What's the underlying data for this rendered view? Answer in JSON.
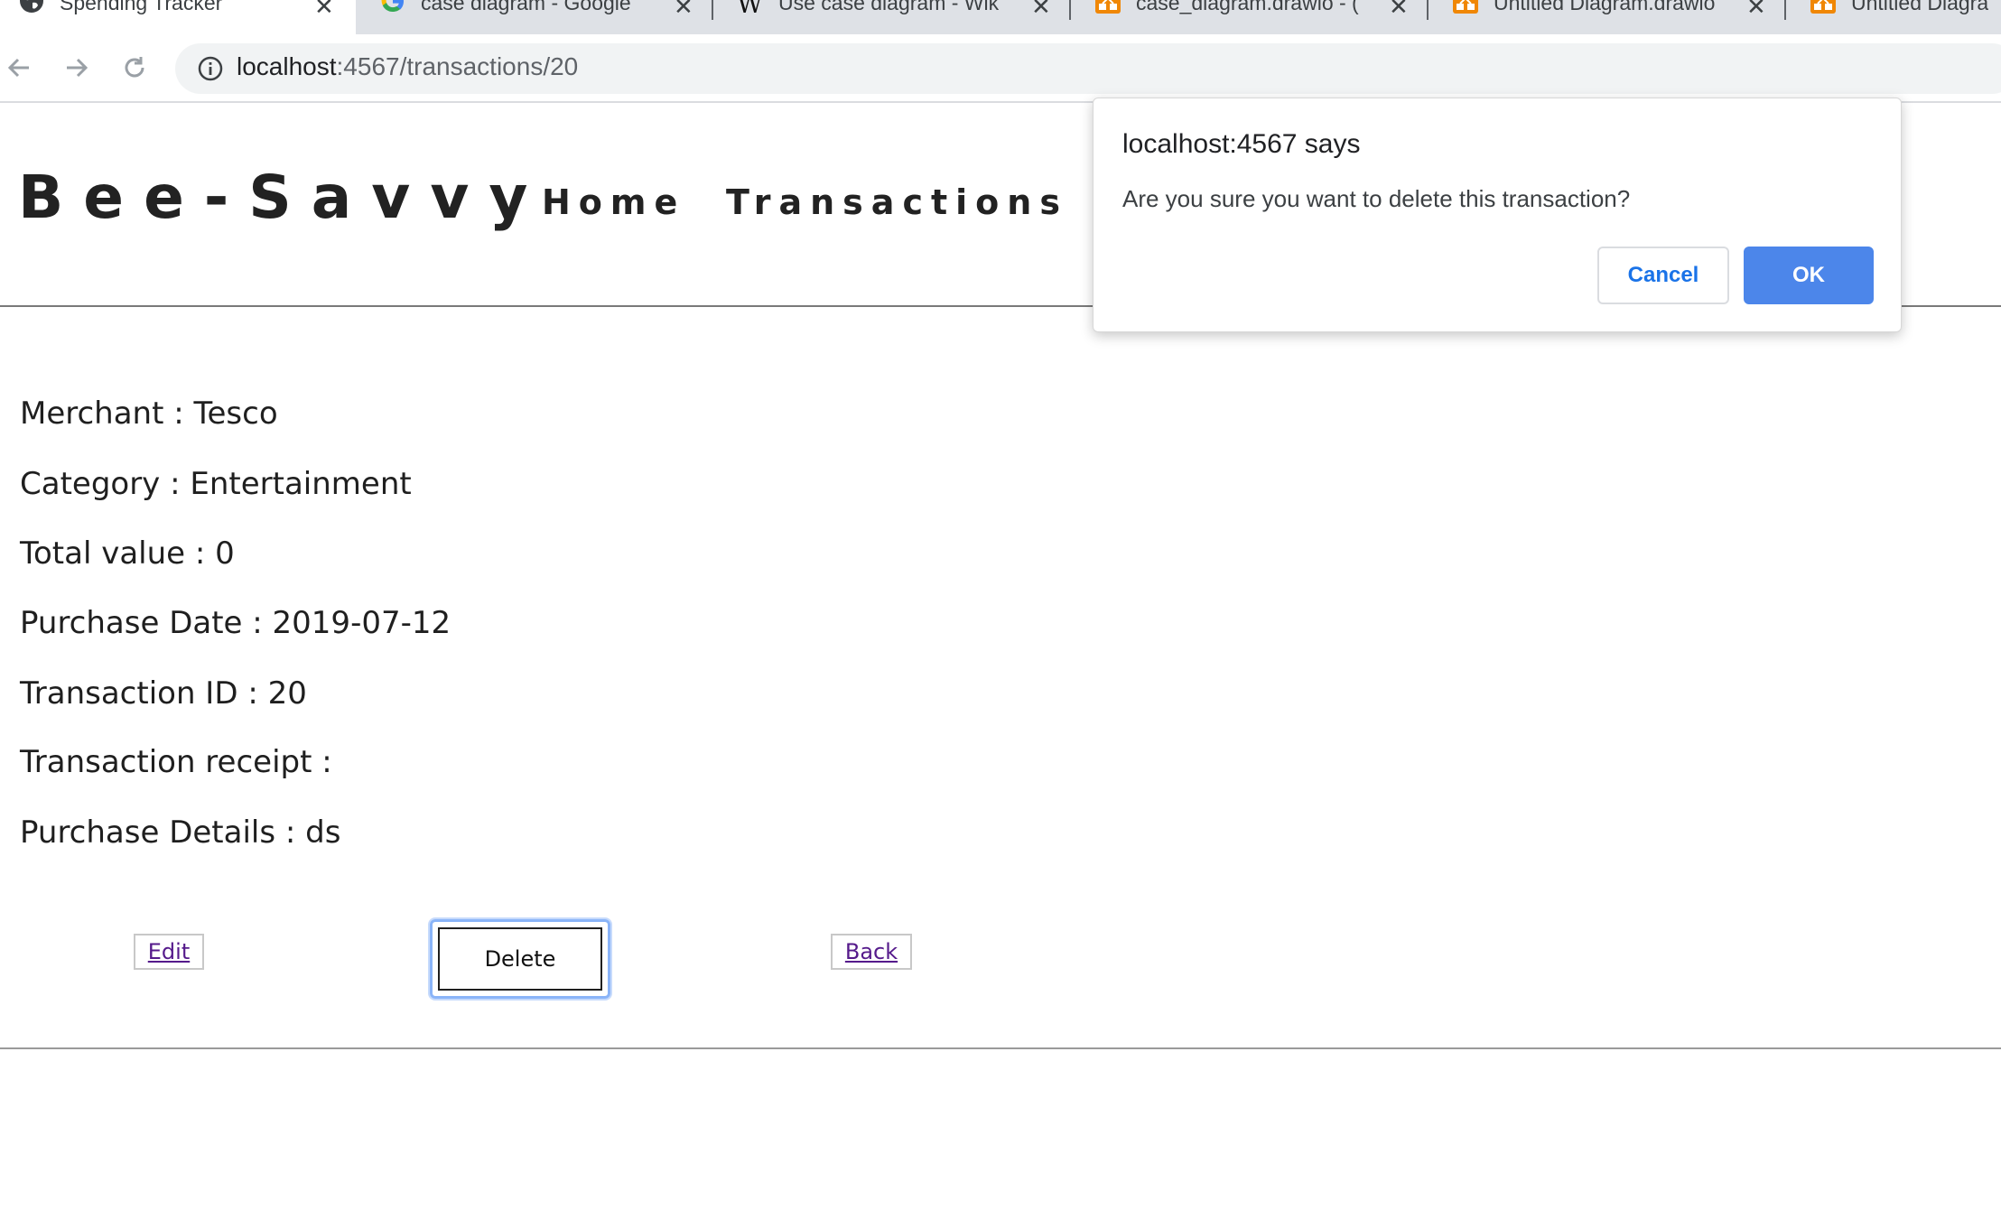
{
  "browser": {
    "tabs": [
      {
        "title": "Spending Tracker",
        "icon": "globe-icon",
        "active": true
      },
      {
        "title": "case diagram - Google",
        "icon": "google-icon",
        "active": false
      },
      {
        "title": "Use case diagram - Wik",
        "icon": "wikipedia-icon",
        "active": false
      },
      {
        "title": "case_diagram.drawio - (",
        "icon": "drawio-icon",
        "active": false
      },
      {
        "title": "Untitled Diagram.drawio",
        "icon": "drawio-icon",
        "active": false
      },
      {
        "title": "Untitled Diagra",
        "icon": "drawio-icon",
        "active": false
      }
    ],
    "url_host": "localhost",
    "url_rest": ":4567/transactions/20",
    "colors": {
      "drawio": "#f08705",
      "google_blue": "#4285f4"
    }
  },
  "site": {
    "brand": "Bee-Savvy",
    "nav": {
      "home": "Home",
      "transactions": "Transactions"
    }
  },
  "transaction": {
    "merchant": "Merchant : Tesco",
    "category": "Category : Entertainment",
    "total": "Total value : 0",
    "date": "Purchase Date : 2019-07-12",
    "id": "Transaction ID : 20",
    "receipt": "Transaction receipt :",
    "details": "Purchase Details : ds"
  },
  "actions": {
    "edit": "Edit",
    "delete": "Delete",
    "back": "Back"
  },
  "dialog": {
    "title": "localhost:4567 says",
    "message": "Are you sure you want to delete this transaction?",
    "cancel": "Cancel",
    "ok": "OK",
    "ok_color": "#4c86ea"
  }
}
